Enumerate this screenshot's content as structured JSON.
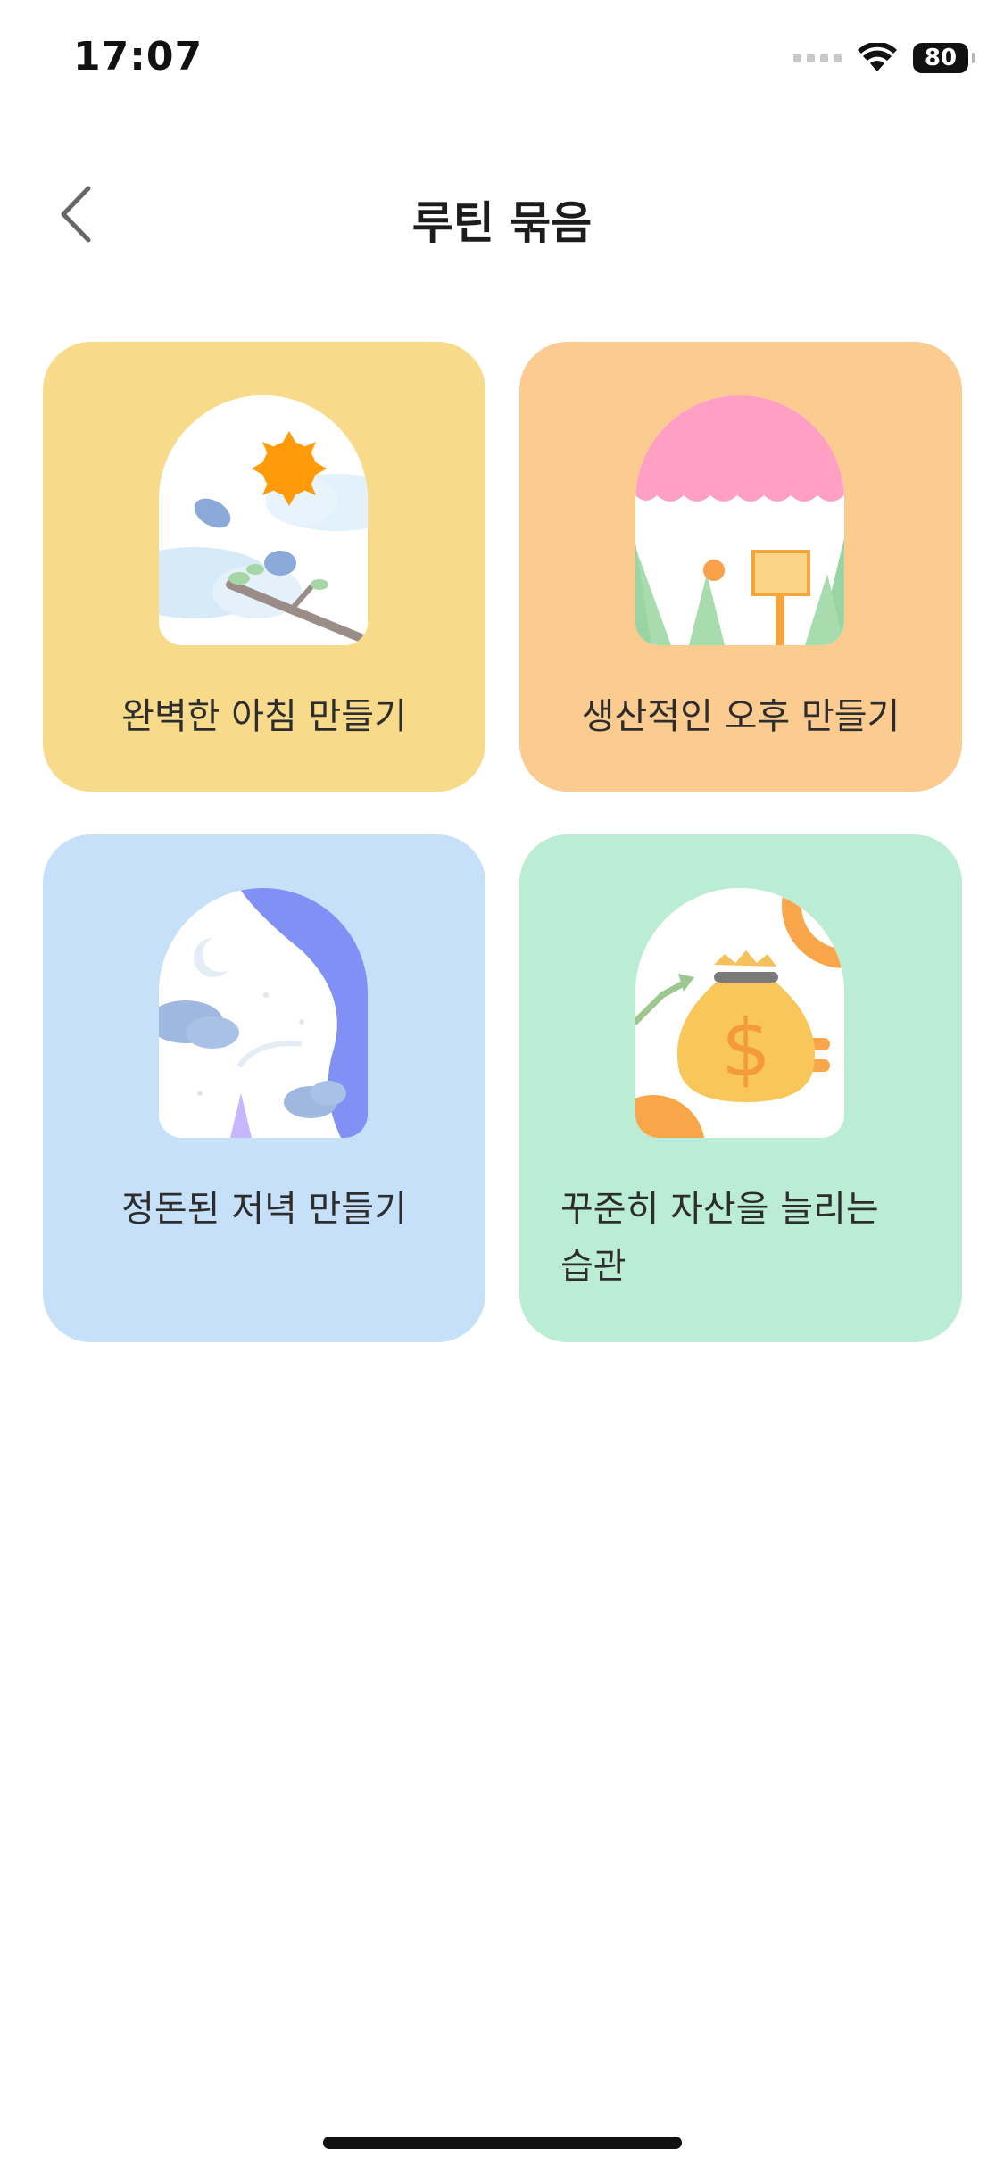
{
  "status_bar": {
    "time": "17:07",
    "battery": "80",
    "signal_icon": "cellular-signal-icon",
    "wifi_icon": "wifi-icon",
    "battery_icon": "battery-icon"
  },
  "header": {
    "title": "루틴 묶음",
    "back_icon": "chevron-left-icon"
  },
  "cards": [
    {
      "label": "완벽한 아침 만들기",
      "color": "#f8da8b",
      "illustration": "morning-icon"
    },
    {
      "label": "생산적인 오후 만들기",
      "color": "#fbcb90",
      "illustration": "afternoon-icon"
    },
    {
      "label": "정돈된 저녁 만들기",
      "color": "#c6e0f9",
      "illustration": "evening-icon"
    },
    {
      "label": "꾸준히 자산을 늘리는 습관",
      "color": "#bbecd4",
      "illustration": "money-bag-icon"
    }
  ]
}
